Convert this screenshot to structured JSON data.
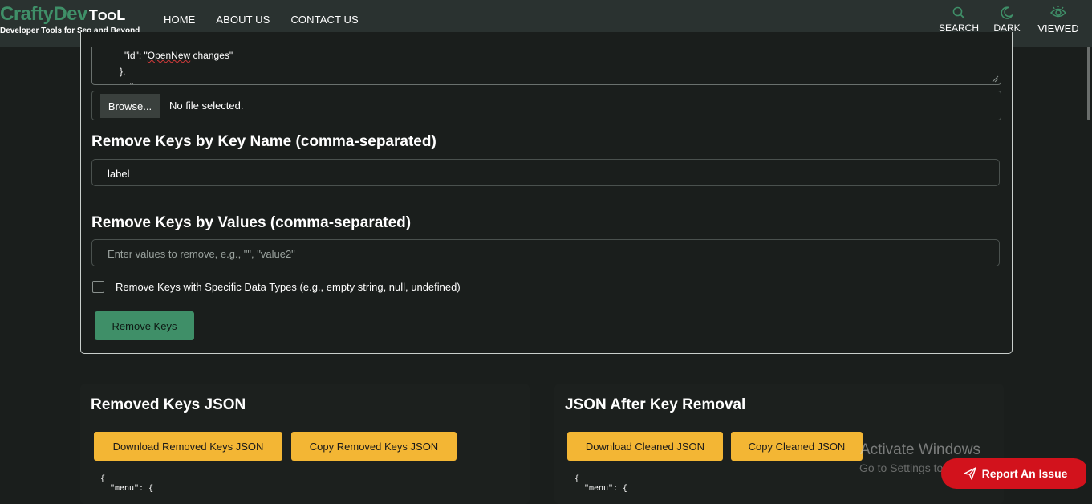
{
  "header": {
    "logo": {
      "crafty": "CraftyDev",
      "tool_first": "T",
      "tool_rest": "OO",
      "tool_last": "L",
      "tagline": "Developer Tools for Seo and Beyond"
    },
    "nav": [
      {
        "label": "HOME"
      },
      {
        "label": "ABOUT US"
      },
      {
        "label": "CONTACT US"
      }
    ],
    "actions": [
      {
        "label": "SEARCH",
        "icon": "search-icon"
      },
      {
        "label": "DARK",
        "icon": "moon-icon"
      },
      {
        "label": "VIEWED",
        "icon": "eye-icon"
      }
    ]
  },
  "editor": {
    "line_top": "",
    "line_id_key": "\"id\": \"",
    "line_id_word": "OpenNew",
    "line_id_rest": " changes\"",
    "line_close": "},",
    "line_null": "null"
  },
  "file_input": {
    "button_label": "Browse...",
    "status": "No file selected."
  },
  "remove_by_name": {
    "heading": "Remove Keys by Key Name (comma-separated)",
    "value": "label"
  },
  "remove_by_value": {
    "heading": "Remove Keys by Values (comma-separated)",
    "placeholder": "Enter values to remove, e.g., \"\", \"value2\""
  },
  "type_option": {
    "label": "Remove Keys with Specific Data Types (e.g., empty string, null, undefined)",
    "checked": false
  },
  "remove_button": "Remove Keys",
  "removed_panel": {
    "heading": "Removed Keys JSON",
    "download_label": "Download Removed Keys JSON",
    "copy_label": "Copy Removed Keys JSON",
    "code_line1": "{",
    "code_line2": "  \"menu\": {"
  },
  "cleaned_panel": {
    "heading": "JSON After Key Removal",
    "download_label": "Download Cleaned JSON",
    "copy_label": "Copy Cleaned JSON",
    "code_line1": "{",
    "code_line2": "  \"menu\": {"
  },
  "watermark": {
    "title": "Activate Windows",
    "subtitle": "Go to Settings to activate Windows."
  },
  "report_button": "Report An Issue",
  "colors": {
    "accent_green": "#3f8f68",
    "button_yellow": "#f3b634",
    "report_red": "#d2121c",
    "background": "#1a1e1c",
    "header": "#2a3230"
  }
}
